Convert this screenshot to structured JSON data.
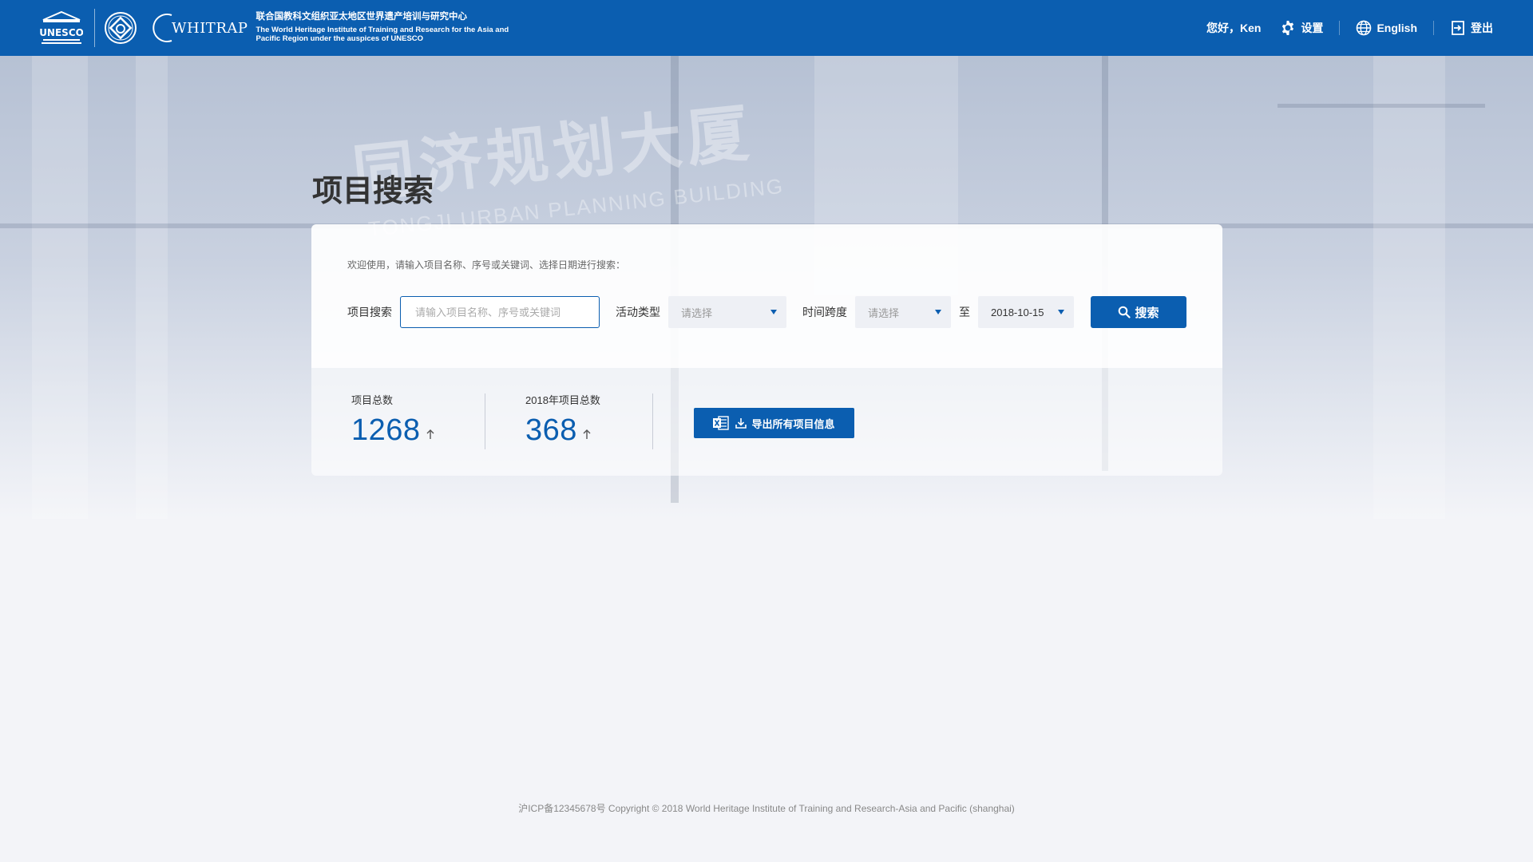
{
  "header": {
    "org_name_cn": "联合国教科文组织亚太地区世界遗产培训与研究中心",
    "org_name_en_line1": "The World Heritage Institute of Training and Research for the Asia and",
    "org_name_en_line2": "Pacific Region under the auspices of UNESCO",
    "logo_unesco_text": "UNESCO",
    "logo_whitrap_text": "WHITRAP",
    "greeting": "您好，Ken",
    "settings_label": "设置",
    "language_label": "English",
    "logout_label": "登出",
    "brand_color": "#0b5eb0"
  },
  "hero": {
    "sign_cn": "同济规划大厦",
    "sign_en": "TONGJI URBAN PLANNING BUILDING"
  },
  "main": {
    "page_title": "项目搜索",
    "welcome": "欢迎使用，请输入项目名称、序号或关键词、选择日期进行搜索：",
    "search": {
      "project_label": "项目搜索",
      "project_placeholder": "请输入项目名称、序号或关键词",
      "project_value": "",
      "activity_label": "活动类型",
      "activity_value": "请选择",
      "time_label": "时间跨度",
      "time_start_value": "请选择",
      "range_to": "至",
      "time_end_value": "2018-10-15",
      "button_label": "搜索"
    },
    "stats": {
      "total_label": "项目总数",
      "total_value": "1268",
      "year_label": "2018年项目总数",
      "year_value": "368",
      "export_label": "导出所有项目信息"
    }
  },
  "footer": {
    "copyright": "沪ICP备12345678号 Copyright © 2018 World Heritage Institute of Training and Research-Asia and Pacific (shanghai)"
  }
}
